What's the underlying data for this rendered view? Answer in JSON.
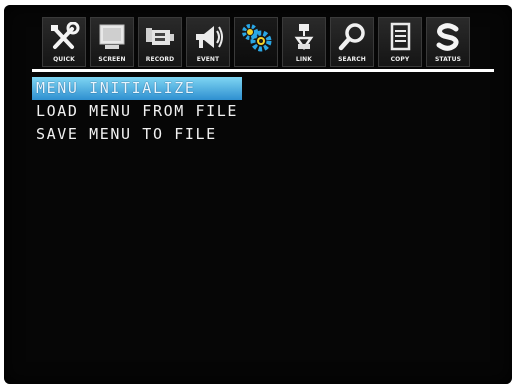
{
  "colors": {
    "screen_background": "#060606",
    "selection_highlight": "#4fb3e6",
    "text": "#f2f2f2"
  },
  "toolbar": {
    "tabs": [
      {
        "label": "QUICK",
        "icon": "tools-icon"
      },
      {
        "label": "SCREEN",
        "icon": "monitor-icon"
      },
      {
        "label": "RECORD",
        "icon": "camera-icon"
      },
      {
        "label": "EVENT",
        "icon": "megaphone-icon"
      },
      {
        "label": "",
        "icon": "gears-icon",
        "active": true
      },
      {
        "label": "LINK",
        "icon": "network-icon"
      },
      {
        "label": "SEARCH",
        "icon": "magnifier-icon"
      },
      {
        "label": "COPY",
        "icon": "document-icon"
      },
      {
        "label": "STATUS",
        "icon": "status-s-icon"
      }
    ]
  },
  "menu": {
    "items": [
      {
        "label": "MENU INITIALIZE",
        "selected": true
      },
      {
        "label": "LOAD MENU FROM FILE",
        "selected": false
      },
      {
        "label": "SAVE MENU TO FILE",
        "selected": false
      }
    ]
  }
}
